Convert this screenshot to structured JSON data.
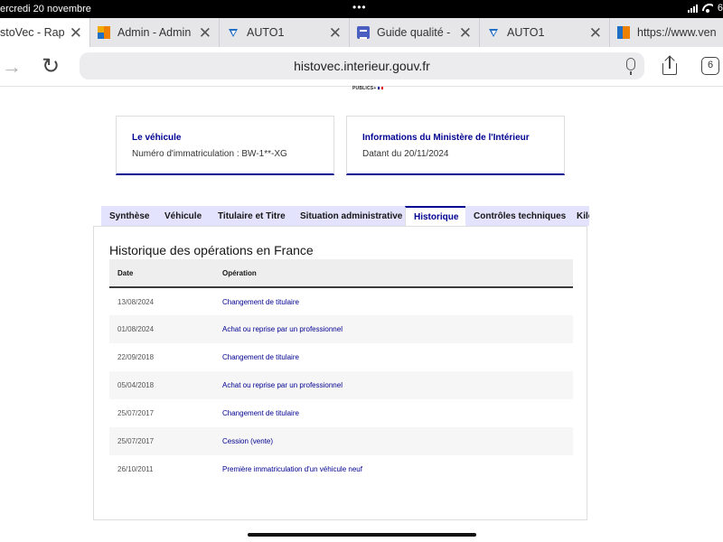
{
  "status_bar": {
    "datetime": "ercredi 20 novembre",
    "dots": "•••",
    "battery_text": "6"
  },
  "browser_tabs": [
    {
      "title": "stoVec - Rappo",
      "favicon": "none",
      "active": true
    },
    {
      "title": "Admin - Admin C",
      "favicon": "orange-grid-icon",
      "active": false
    },
    {
      "title": "AUTO1",
      "favicon": "auto1-icon",
      "active": false
    },
    {
      "title": "Guide qualité - C",
      "favicon": "doc-icon",
      "active": false
    },
    {
      "title": "AUTO1",
      "favicon": "auto1-icon",
      "active": false
    },
    {
      "title": "https://www.vend",
      "favicon": "bar-icon",
      "active": false
    }
  ],
  "toolbar": {
    "url": "histovec.interieur.gouv.fr",
    "tab_count": "6"
  },
  "logo_fragment": "PUBLICS+",
  "vehicle_card": {
    "title": "Le véhicule",
    "text": "Numéro d'immatriculation : BW-1**-XG"
  },
  "ministry_card": {
    "title": "Informations du Ministère de l'Intérieur",
    "text": "Datant du 20/11/2024"
  },
  "tabs": [
    {
      "label": "Synthèse",
      "active": false
    },
    {
      "label": "Véhicule",
      "active": false
    },
    {
      "label": "Titulaire et Titre",
      "active": false
    },
    {
      "label": "Situation administrative",
      "active": false
    },
    {
      "label": "Historique",
      "active": true
    },
    {
      "label": "Contrôles techniques",
      "active": false
    },
    {
      "label": "Kilométrage",
      "active": false
    }
  ],
  "history": {
    "title": "Historique des opérations en France",
    "col_date": "Date",
    "col_operation": "Opération",
    "rows": [
      {
        "date": "13/08/2024",
        "operation": "Changement de titulaire"
      },
      {
        "date": "01/08/2024",
        "operation": "Achat ou reprise par un professionnel"
      },
      {
        "date": "22/09/2018",
        "operation": "Changement de titulaire"
      },
      {
        "date": "05/04/2018",
        "operation": "Achat ou reprise par un professionnel"
      },
      {
        "date": "25/07/2017",
        "operation": "Changement de titulaire"
      },
      {
        "date": "25/07/2017",
        "operation": "Cession (vente)"
      },
      {
        "date": "26/10/2011",
        "operation": "Première immatriculation d'un véhicule neuf"
      }
    ]
  },
  "colors": {
    "accent": "#000091",
    "tab_bg": "#e3e3fd",
    "row_alt": "#f6f6f6",
    "header_bg": "#eeeeee"
  }
}
